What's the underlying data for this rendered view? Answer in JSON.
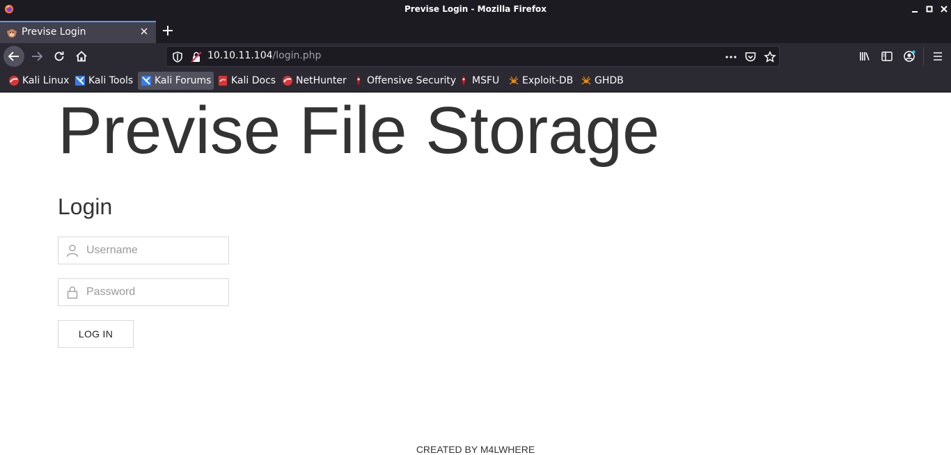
{
  "window": {
    "title": "Previse Login - Mozilla Firefox",
    "minimize_glyph": "▁",
    "maximize_glyph": "□",
    "close_glyph": "✕"
  },
  "tabs": [
    {
      "label": "Previse Login",
      "icon": "monkey-favicon-icon",
      "active": true
    }
  ],
  "navbar": {
    "url_host": "10.10.11.104",
    "url_path": "/login.php"
  },
  "bookmarks": [
    {
      "label": "Kali Linux",
      "icon": "kali-dragon-icon"
    },
    {
      "label": "Kali Tools",
      "icon": "kali-tools-icon"
    },
    {
      "label": "Kali Forums",
      "icon": "kali-forums-icon",
      "active": true
    },
    {
      "label": "Kali Docs",
      "icon": "kali-docs-icon"
    },
    {
      "label": "NetHunter",
      "icon": "kali-dragon-icon"
    },
    {
      "label": "Offensive Security",
      "icon": "offsec-icon"
    },
    {
      "label": "MSFU",
      "icon": "offsec-icon"
    },
    {
      "label": "Exploit-DB",
      "icon": "exploit-db-spider-icon"
    },
    {
      "label": "GHDB",
      "icon": "exploit-db-spider-icon"
    }
  ],
  "page": {
    "site_title": "Previse File Storage",
    "login_heading": "Login",
    "username_placeholder": "Username",
    "password_placeholder": "Password",
    "login_button": "LOG IN",
    "footer": "CREATED BY M4LWHERE"
  },
  "colors": {
    "chrome_dark": "#1c1b22",
    "chrome_mid": "#2b2a33",
    "tab_active": "#42414d",
    "tab_accent": "#5b9cf8",
    "text_dark": "#333333"
  }
}
